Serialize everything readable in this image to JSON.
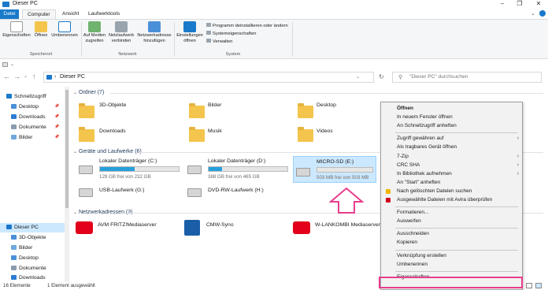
{
  "window": {
    "title": "Dieser PC",
    "controls": [
      "–",
      "❐",
      "✕"
    ]
  },
  "ribbon_tabs": [
    {
      "label": "Datei"
    },
    {
      "label": "Computer"
    },
    {
      "label": "Ansicht"
    },
    {
      "label": "Laufwerktools"
    }
  ],
  "ribbon": {
    "groups": [
      {
        "label": "Speicherort",
        "buttons": [
          "Eigenschaften",
          "Öffnen",
          "Umbenennen"
        ]
      },
      {
        "label": "Netzwerk",
        "buttons": [
          "Auf Medien zugreifen",
          "Netzlaufwerk verbinden",
          "Netzwerkadresse hinzufügen"
        ]
      },
      {
        "label": "System",
        "buttons": [
          "Einstellungen öffnen"
        ],
        "small_buttons": [
          "Programm deinstallieren oder ändern",
          "Systemeigenschaften",
          "Verwalten"
        ]
      }
    ]
  },
  "address": {
    "path": "Dieser PC",
    "search_placeholder": "\"Dieser PC\" durchsuchen"
  },
  "nav": {
    "items": [
      {
        "label": "Schnellzugriff",
        "pinned": false
      },
      {
        "label": "Desktop",
        "pinned": true
      },
      {
        "label": "Downloads",
        "pinned": true
      },
      {
        "label": "Dokumente",
        "pinned": true
      },
      {
        "label": "Bilder",
        "pinned": true
      },
      {
        "label": "Dieser PC",
        "pinned": false
      },
      {
        "label": "3D-Objekte",
        "pinned": false
      },
      {
        "label": "Bilder",
        "pinned": false
      },
      {
        "label": "Desktop",
        "pinned": false
      },
      {
        "label": "Dokumente",
        "pinned": false
      },
      {
        "label": "Downloads",
        "pinned": false
      }
    ],
    "pin_glyph": "📌"
  },
  "sections": {
    "folders": {
      "header": "Ordner (7)",
      "items": [
        "3D-Objekte",
        "Bilder",
        "Desktop",
        "Downloads",
        "Musik",
        "Videos"
      ]
    },
    "drives": {
      "header": "Geräte und Laufwerke (6)",
      "items": [
        {
          "name": "Lokaler Datenträger (C:)",
          "free": "129 GB frei von 232 GB",
          "fill": 0.44
        },
        {
          "name": "Lokaler Datenträger (D:)",
          "free": "388 GB frei von 465 GB",
          "fill": 0.17
        },
        {
          "name": "MICRO-SD (E:)",
          "free": "503 MB frei von 503 MB",
          "fill": 0.0
        },
        {
          "name": "USB-Laufwerk (G:)",
          "free": "",
          "fill": null
        },
        {
          "name": "DVD-RW-Laufwerk (H:)",
          "free": "",
          "fill": null
        }
      ]
    },
    "network": {
      "header": "Netzwerkadressen (3)",
      "items": [
        "AVM FRITZ!Mediaserver",
        "CMW-Syno",
        "W-LANKOMBI Mediaserver"
      ]
    }
  },
  "status": {
    "count": "16 Elemente",
    "selected": "1 Element ausgewählt"
  },
  "context_menu": {
    "items": [
      {
        "label": "Öffnen",
        "bold": true
      },
      {
        "label": "In neuem Fenster öffnen"
      },
      {
        "label": "An Schnellzugriff anheften"
      },
      {
        "sep": true
      },
      {
        "label": "Zugriff gewähren auf",
        "sub": true
      },
      {
        "label": "Als tragbares Gerät öffnen"
      },
      {
        "label": "7-Zip",
        "sub": true
      },
      {
        "label": "CRC SHA",
        "sub": true
      },
      {
        "label": "In Bibliothek aufnehmen",
        "sub": true
      },
      {
        "label": "An \"Start\" anheften"
      },
      {
        "label": "Nach gelöschten Dateien suchen",
        "icon": "#f2b600"
      },
      {
        "label": "Ausgewählte Dateien mit Avira überprüfen",
        "icon": "#d0021b"
      },
      {
        "sep": true
      },
      {
        "label": "Formatieren..."
      },
      {
        "label": "Auswerfen"
      },
      {
        "sep": true
      },
      {
        "label": "Ausschneiden"
      },
      {
        "label": "Kopieren"
      },
      {
        "sep": true
      },
      {
        "label": "Verknüpfung erstellen"
      },
      {
        "label": "Umbenennen"
      },
      {
        "sep": true
      },
      {
        "label": "Eigenschaften"
      }
    ]
  },
  "colors": {
    "accent": "#1979ca",
    "selection": "#cce8ff",
    "highlight": "#e83e8c",
    "folder": "#f4c54d",
    "drive_fill": "#26a0da"
  }
}
